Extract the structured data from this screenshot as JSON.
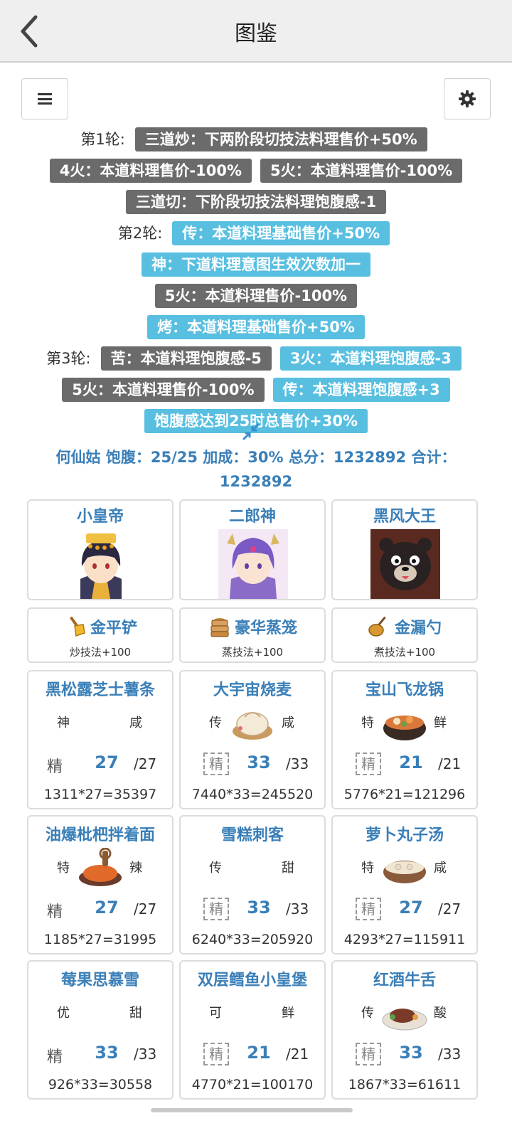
{
  "header": {
    "title": "图鉴",
    "back_icon": "chevron-left-icon"
  },
  "toolbar": {
    "menu_icon": "menu-icon",
    "settings_icon": "gear-icon"
  },
  "rounds": [
    {
      "label": "第1轮:",
      "chips": [
        {
          "text": "三道炒：下两阶段切技法料理售价+50%",
          "color": "gray"
        },
        {
          "text": "4火：本道料理售价-100%",
          "color": "gray"
        },
        {
          "text": "5火：本道料理售价-100%",
          "color": "gray"
        },
        {
          "text": "三道切：下阶段切技法料理饱腹感-1",
          "color": "gray"
        }
      ]
    },
    {
      "label": "第2轮:",
      "chips": [
        {
          "text": "传：本道料理基础售价+50%",
          "color": "blue"
        },
        {
          "text": "神：下道料理意图生效次数加一",
          "color": "blue"
        },
        {
          "text": "5火：本道料理售价-100%",
          "color": "gray"
        },
        {
          "text": "烤：本道料理基础售价+50%",
          "color": "blue"
        }
      ]
    },
    {
      "label": "第3轮:",
      "chips": [
        {
          "text": "苦：本道料理饱腹感-5",
          "color": "gray"
        },
        {
          "text": "3火：本道料理饱腹感-3",
          "color": "blue"
        },
        {
          "text": "5火：本道料理售价-100%",
          "color": "gray"
        },
        {
          "text": "传：本道料理饱腹感+3",
          "color": "blue"
        },
        {
          "text": "饱腹感达到25时总售价+30%",
          "color": "blue"
        }
      ]
    }
  ],
  "summary": {
    "line1": "何仙姑 饱腹：25/25 加成：30% 总分：1232892 合计：",
    "line2": "1232892"
  },
  "chefs": [
    {
      "name": "小皇帝"
    },
    {
      "name": "二郎神"
    },
    {
      "name": "黑风大王"
    }
  ],
  "equipment": [
    {
      "name": "金平铲",
      "skill": "炒技法+100",
      "icon": "golden-spatula-icon"
    },
    {
      "name": "豪华蒸笼",
      "skill": "蒸技法+100",
      "icon": "steamer-icon"
    },
    {
      "name": "金漏勺",
      "skill": "煮技法+100",
      "icon": "ladle-icon"
    }
  ],
  "dishes": [
    {
      "name": "黑松露芝士薯条",
      "rarity": "神",
      "taste": "咸",
      "grade": "精",
      "count": "27",
      "max": "/27",
      "calc": "1311*27=35397",
      "img": "",
      "dashed": false
    },
    {
      "name": "大宇宙烧麦",
      "rarity": "传",
      "taste": "咸",
      "grade": "精",
      "count": "33",
      "max": "/33",
      "calc": "7440*33=245520",
      "img": "dumpling",
      "dashed": true
    },
    {
      "name": "宝山飞龙锅",
      "rarity": "特",
      "taste": "鲜",
      "grade": "精",
      "count": "21",
      "max": "/21",
      "calc": "5776*21=121296",
      "img": "pot",
      "dashed": true
    },
    {
      "name": "油爆枇杷拌着面",
      "rarity": "特",
      "taste": "辣",
      "grade": "精",
      "count": "27",
      "max": "/27",
      "calc": "1185*27=31995",
      "img": "crab",
      "dashed": false
    },
    {
      "name": "雪糕刺客",
      "rarity": "传",
      "taste": "甜",
      "grade": "精",
      "count": "33",
      "max": "/33",
      "calc": "6240*33=205920",
      "img": "",
      "dashed": true
    },
    {
      "name": "萝卜丸子汤",
      "rarity": "特",
      "taste": "咸",
      "grade": "精",
      "count": "27",
      "max": "/27",
      "calc": "4293*27=115911",
      "img": "soup",
      "dashed": true
    },
    {
      "name": "莓果思慕雪",
      "rarity": "优",
      "taste": "甜",
      "grade": "精",
      "count": "33",
      "max": "/33",
      "calc": "926*33=30558",
      "img": "",
      "dashed": false
    },
    {
      "name": "双层鳕鱼小皇堡",
      "rarity": "可",
      "taste": "鲜",
      "grade": "精",
      "count": "21",
      "max": "/21",
      "calc": "4770*21=100170",
      "img": "",
      "dashed": true
    },
    {
      "name": "红酒牛舌",
      "rarity": "传",
      "taste": "酸",
      "grade": "精",
      "count": "33",
      "max": "/33",
      "calc": "1867*33=61611",
      "img": "beef",
      "dashed": true
    }
  ]
}
